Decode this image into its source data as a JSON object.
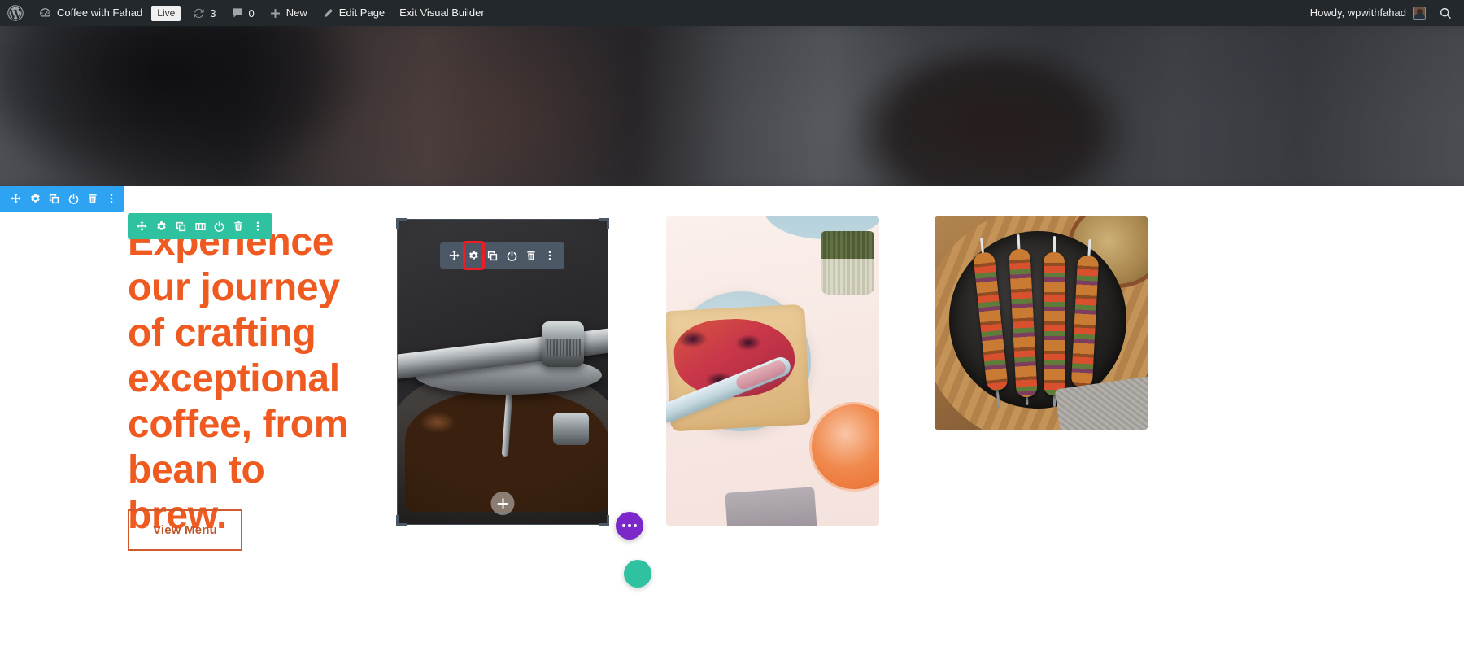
{
  "admin_bar": {
    "wp_logo_icon": "wordpress-logo-icon",
    "site_dashboard_icon": "dashboard-speedometer-icon",
    "site_name": "Coffee with Fahad",
    "live_badge": "Live",
    "updates_icon": "updates-sync-icon",
    "updates_count": "3",
    "comments_icon": "comment-bubble-icon",
    "comments_count": "0",
    "new_icon": "plus-icon",
    "new_label": "New",
    "edit_icon": "pencil-icon",
    "edit_label": "Edit Page",
    "exit_label": "Exit Visual Builder",
    "howdy_label": "Howdy, wpwithfahad",
    "avatar_icon": "user-avatar",
    "search_icon": "search-icon"
  },
  "section_toolbar": {
    "name": "section-toolbar",
    "color": "#2ea3f2",
    "buttons": [
      {
        "icon": "move-arrows-icon",
        "label": "Move Section"
      },
      {
        "icon": "gear-icon",
        "label": "Section Settings"
      },
      {
        "icon": "duplicate-icon",
        "label": "Duplicate Section"
      },
      {
        "icon": "power-icon",
        "label": "Disable Section"
      },
      {
        "icon": "trash-icon",
        "label": "Delete Section"
      },
      {
        "icon": "ellipsis-vertical-icon",
        "label": "More Options"
      }
    ]
  },
  "row_toolbar": {
    "name": "row-toolbar",
    "color": "#2ec2a1",
    "buttons": [
      {
        "icon": "move-arrows-icon",
        "label": "Move Row"
      },
      {
        "icon": "gear-icon",
        "label": "Row Settings"
      },
      {
        "icon": "duplicate-icon",
        "label": "Duplicate Row"
      },
      {
        "icon": "columns-icon",
        "label": "Change Column Structure"
      },
      {
        "icon": "power-icon",
        "label": "Disable Row"
      },
      {
        "icon": "trash-icon",
        "label": "Delete Row"
      },
      {
        "icon": "ellipsis-vertical-icon",
        "label": "More Options"
      }
    ]
  },
  "module_toolbar": {
    "name": "module-toolbar",
    "color": "#4c5866",
    "highlight_color": "#ee1c25",
    "highlighted_button": "gear-icon",
    "buttons": [
      {
        "icon": "move-arrows-icon",
        "label": "Move Module"
      },
      {
        "icon": "gear-icon",
        "label": "Module Settings"
      },
      {
        "icon": "duplicate-icon",
        "label": "Duplicate Module"
      },
      {
        "icon": "power-icon",
        "label": "Disable Module"
      },
      {
        "icon": "trash-icon",
        "label": "Delete Module"
      },
      {
        "icon": "ellipsis-vertical-icon",
        "label": "More Options"
      }
    ]
  },
  "hero": {
    "background_image": "blurred-coffee-brewing-photo",
    "heading": "Experience\nour journey\nof crafting\nexceptional\ncoffee, from\nbean to brew.",
    "heading_color": "#ef5a20",
    "button_label": "View Menu",
    "button_border_color": "#d2592a"
  },
  "gallery": {
    "images": [
      {
        "name": "coffee-grinder-beans-image",
        "selected": true
      },
      {
        "name": "toast-with-jam-image",
        "selected": false
      },
      {
        "name": "grilled-kebab-skillet-image",
        "selected": false
      }
    ],
    "add_module_icon": "plus-icon"
  },
  "floating_buttons": [
    {
      "name": "visual-builder-menu-fab",
      "icon": "ellipsis-horizontal-icon",
      "color": "#7b27c9"
    },
    {
      "name": "visual-builder-secondary-fab",
      "icon": "circle-icon",
      "color": "#2ec2a1"
    }
  ]
}
